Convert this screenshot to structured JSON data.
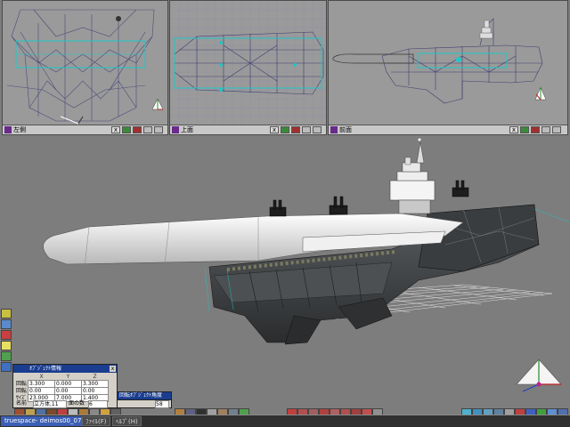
{
  "viewports": [
    {
      "id": "left",
      "title": "左側",
      "controls": [
        "x",
        "□",
        "◎",
        "▢",
        "▢"
      ]
    },
    {
      "id": "top",
      "title": "上面",
      "controls": [
        "x",
        "□",
        "◎",
        "▢",
        "▢"
      ]
    },
    {
      "id": "front",
      "title": "前面",
      "controls": [
        "x",
        "□",
        "◎",
        "▢",
        "▢"
      ]
    }
  ],
  "coordinate_window": {
    "title": "ｵﾌﾞｼﾞｪｸﾄ情報",
    "columns": [
      "X",
      "Y",
      "Z"
    ],
    "rows": [
      {
        "label": "回転",
        "values": [
          "3.300",
          "0.000",
          "3.300"
        ]
      },
      {
        "label": "回転",
        "values": [
          "0.00",
          "0.00",
          "0.00"
        ]
      },
      {
        "label": "ｻｲｽﾞ",
        "values": [
          "23.000",
          "7.000",
          "1.400"
        ]
      }
    ],
    "name_label": "名前",
    "name_value": "立方体,11",
    "face_label": "面の数",
    "face_value": "6"
  },
  "speed_panel": {
    "title": "回転ｵﾌﾞｼﾞｪｸﾄ角度",
    "value": "58"
  },
  "taskbar": {
    "start_label": "truespace- deimos00_07",
    "items": [
      "ﾌｧｲﾙ(F)",
      "ﾍﾙﾌﾟ(H)"
    ]
  },
  "colors": {
    "desktop": "#7d7d7d",
    "viewport_bg": "#9a9a9a",
    "accent_cyan": "#1ec8c8",
    "wire": "#4a4a8a"
  }
}
